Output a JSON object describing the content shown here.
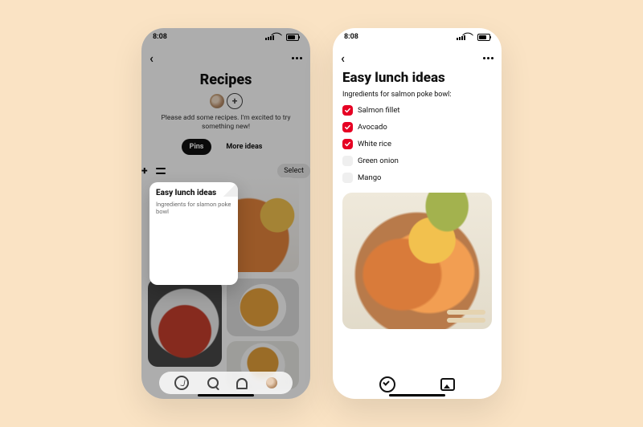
{
  "status": {
    "time": "8:08"
  },
  "left": {
    "board_title": "Recipes",
    "description": "Please add some recipes. I'm excited to try something new!",
    "tabs": {
      "pins": "Pins",
      "more_ideas": "More ideas"
    },
    "toolbar": {
      "select": "Select"
    },
    "note": {
      "title": "Easy lunch ideas",
      "subtitle": "Ingredients for slamon poke bowl"
    }
  },
  "right": {
    "title": "Easy lunch ideas",
    "subtitle": "Ingredients for salmon poke bowl:",
    "ingredients": [
      {
        "label": "Salmon fillet",
        "checked": true
      },
      {
        "label": "Avocado",
        "checked": true
      },
      {
        "label": "White rice",
        "checked": true
      },
      {
        "label": "Green onion",
        "checked": false
      },
      {
        "label": "Mango",
        "checked": false
      }
    ]
  }
}
